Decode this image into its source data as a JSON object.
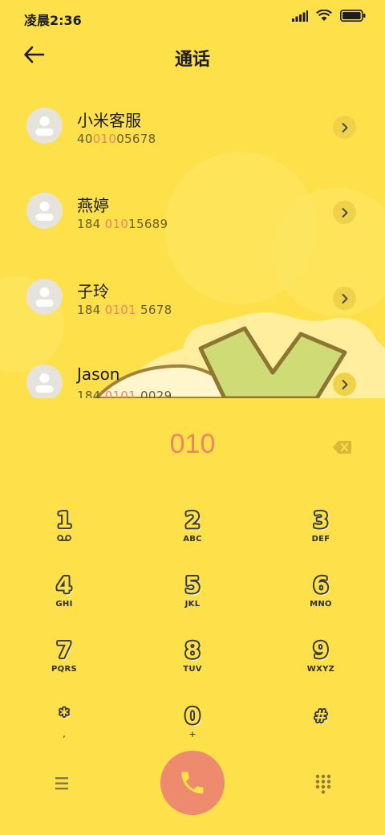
{
  "status": {
    "time": "凌晨2:36",
    "icons": [
      "signal-icon",
      "wifi-icon",
      "battery-icon"
    ]
  },
  "header": {
    "title": "通话",
    "back_icon": "arrow-left-icon"
  },
  "contacts": [
    {
      "name": "小米客服",
      "number_parts": [
        "40",
        "010",
        "05678"
      ]
    },
    {
      "name": "燕婷",
      "number_parts": [
        "184 ",
        "010",
        "15689"
      ]
    },
    {
      "name": "子玲",
      "number_parts": [
        "184 ",
        "0101",
        " 5678"
      ]
    },
    {
      "name": "Jason",
      "number_parts": [
        "184 ",
        "0101",
        " 0029"
      ]
    }
  ],
  "dial": {
    "input": "010",
    "backspace_icon": "backspace-icon"
  },
  "keypad": [
    {
      "digit": "1",
      "sub": "voicemail"
    },
    {
      "digit": "2",
      "sub": "ABC"
    },
    {
      "digit": "3",
      "sub": "DEF"
    },
    {
      "digit": "4",
      "sub": "GHI"
    },
    {
      "digit": "5",
      "sub": "JKL"
    },
    {
      "digit": "6",
      "sub": "MNO"
    },
    {
      "digit": "7",
      "sub": "PQRS"
    },
    {
      "digit": "8",
      "sub": "TUV"
    },
    {
      "digit": "9",
      "sub": "WXYZ"
    },
    {
      "digit": "*",
      "sub": ","
    },
    {
      "digit": "0",
      "sub": "+"
    },
    {
      "digit": "#",
      "sub": ""
    }
  ],
  "bottom": {
    "menu_icon": "menu-icon",
    "call_icon": "phone-icon",
    "dialpad_icon": "dialpad-icon"
  },
  "colors": {
    "background": "#fde04a",
    "highlight": "#ef8467",
    "call_button": "#ee8a6d"
  }
}
